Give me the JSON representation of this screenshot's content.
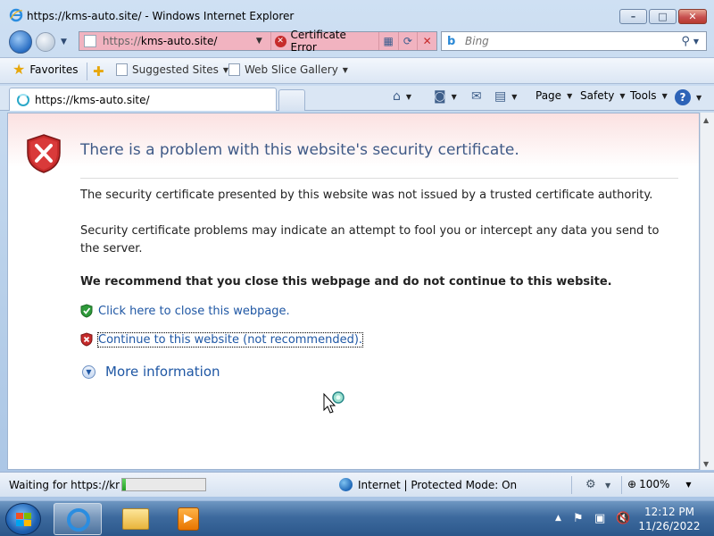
{
  "window": {
    "title": "https://kms-auto.site/ - Windows Internet Explorer",
    "minimize_glyph": "–",
    "maximize_glyph": "□",
    "close_glyph": "✕"
  },
  "address_bar": {
    "scheme": "https://",
    "host": "kms-auto.site/",
    "certificate_error_label": "Certificate Error",
    "background_color": "#f1b3c0"
  },
  "search": {
    "placeholder": "Bing",
    "logo": "b"
  },
  "favorites_bar": {
    "favorites_label": "Favorites",
    "links": [
      "Suggested Sites",
      "Web Slice Gallery"
    ]
  },
  "tab": {
    "label": "https://kms-auto.site/"
  },
  "command_bar": {
    "page_label": "Page",
    "safety_label": "Safety",
    "tools_label": "Tools",
    "help_glyph": "?"
  },
  "error_page": {
    "title": "There is a problem with this website's security certificate.",
    "paragraph1": "The security certificate presented by this website was not issued by a trusted certificate authority.",
    "paragraph2": "Security certificate problems may indicate an attempt to fool you or intercept any data you send to the server.",
    "recommendation": "We recommend that you close this webpage and do not continue to this website.",
    "close_link": "Click here to close this webpage.",
    "continue_link": "Continue to this website (not recommended).",
    "more_info": "More information",
    "title_color": "#3f5a87",
    "link_color": "#1f57a4"
  },
  "status_bar": {
    "status_text": "Waiting for https://kms",
    "progress_fraction": 0.04,
    "zone_text": "Internet | Protected Mode: On",
    "zoom_text": "100%"
  },
  "taskbar": {
    "time": "12:12 PM",
    "date": "11/26/2022",
    "pinned": [
      "internet-explorer-icon",
      "folder-icon",
      "media-player-icon"
    ]
  }
}
